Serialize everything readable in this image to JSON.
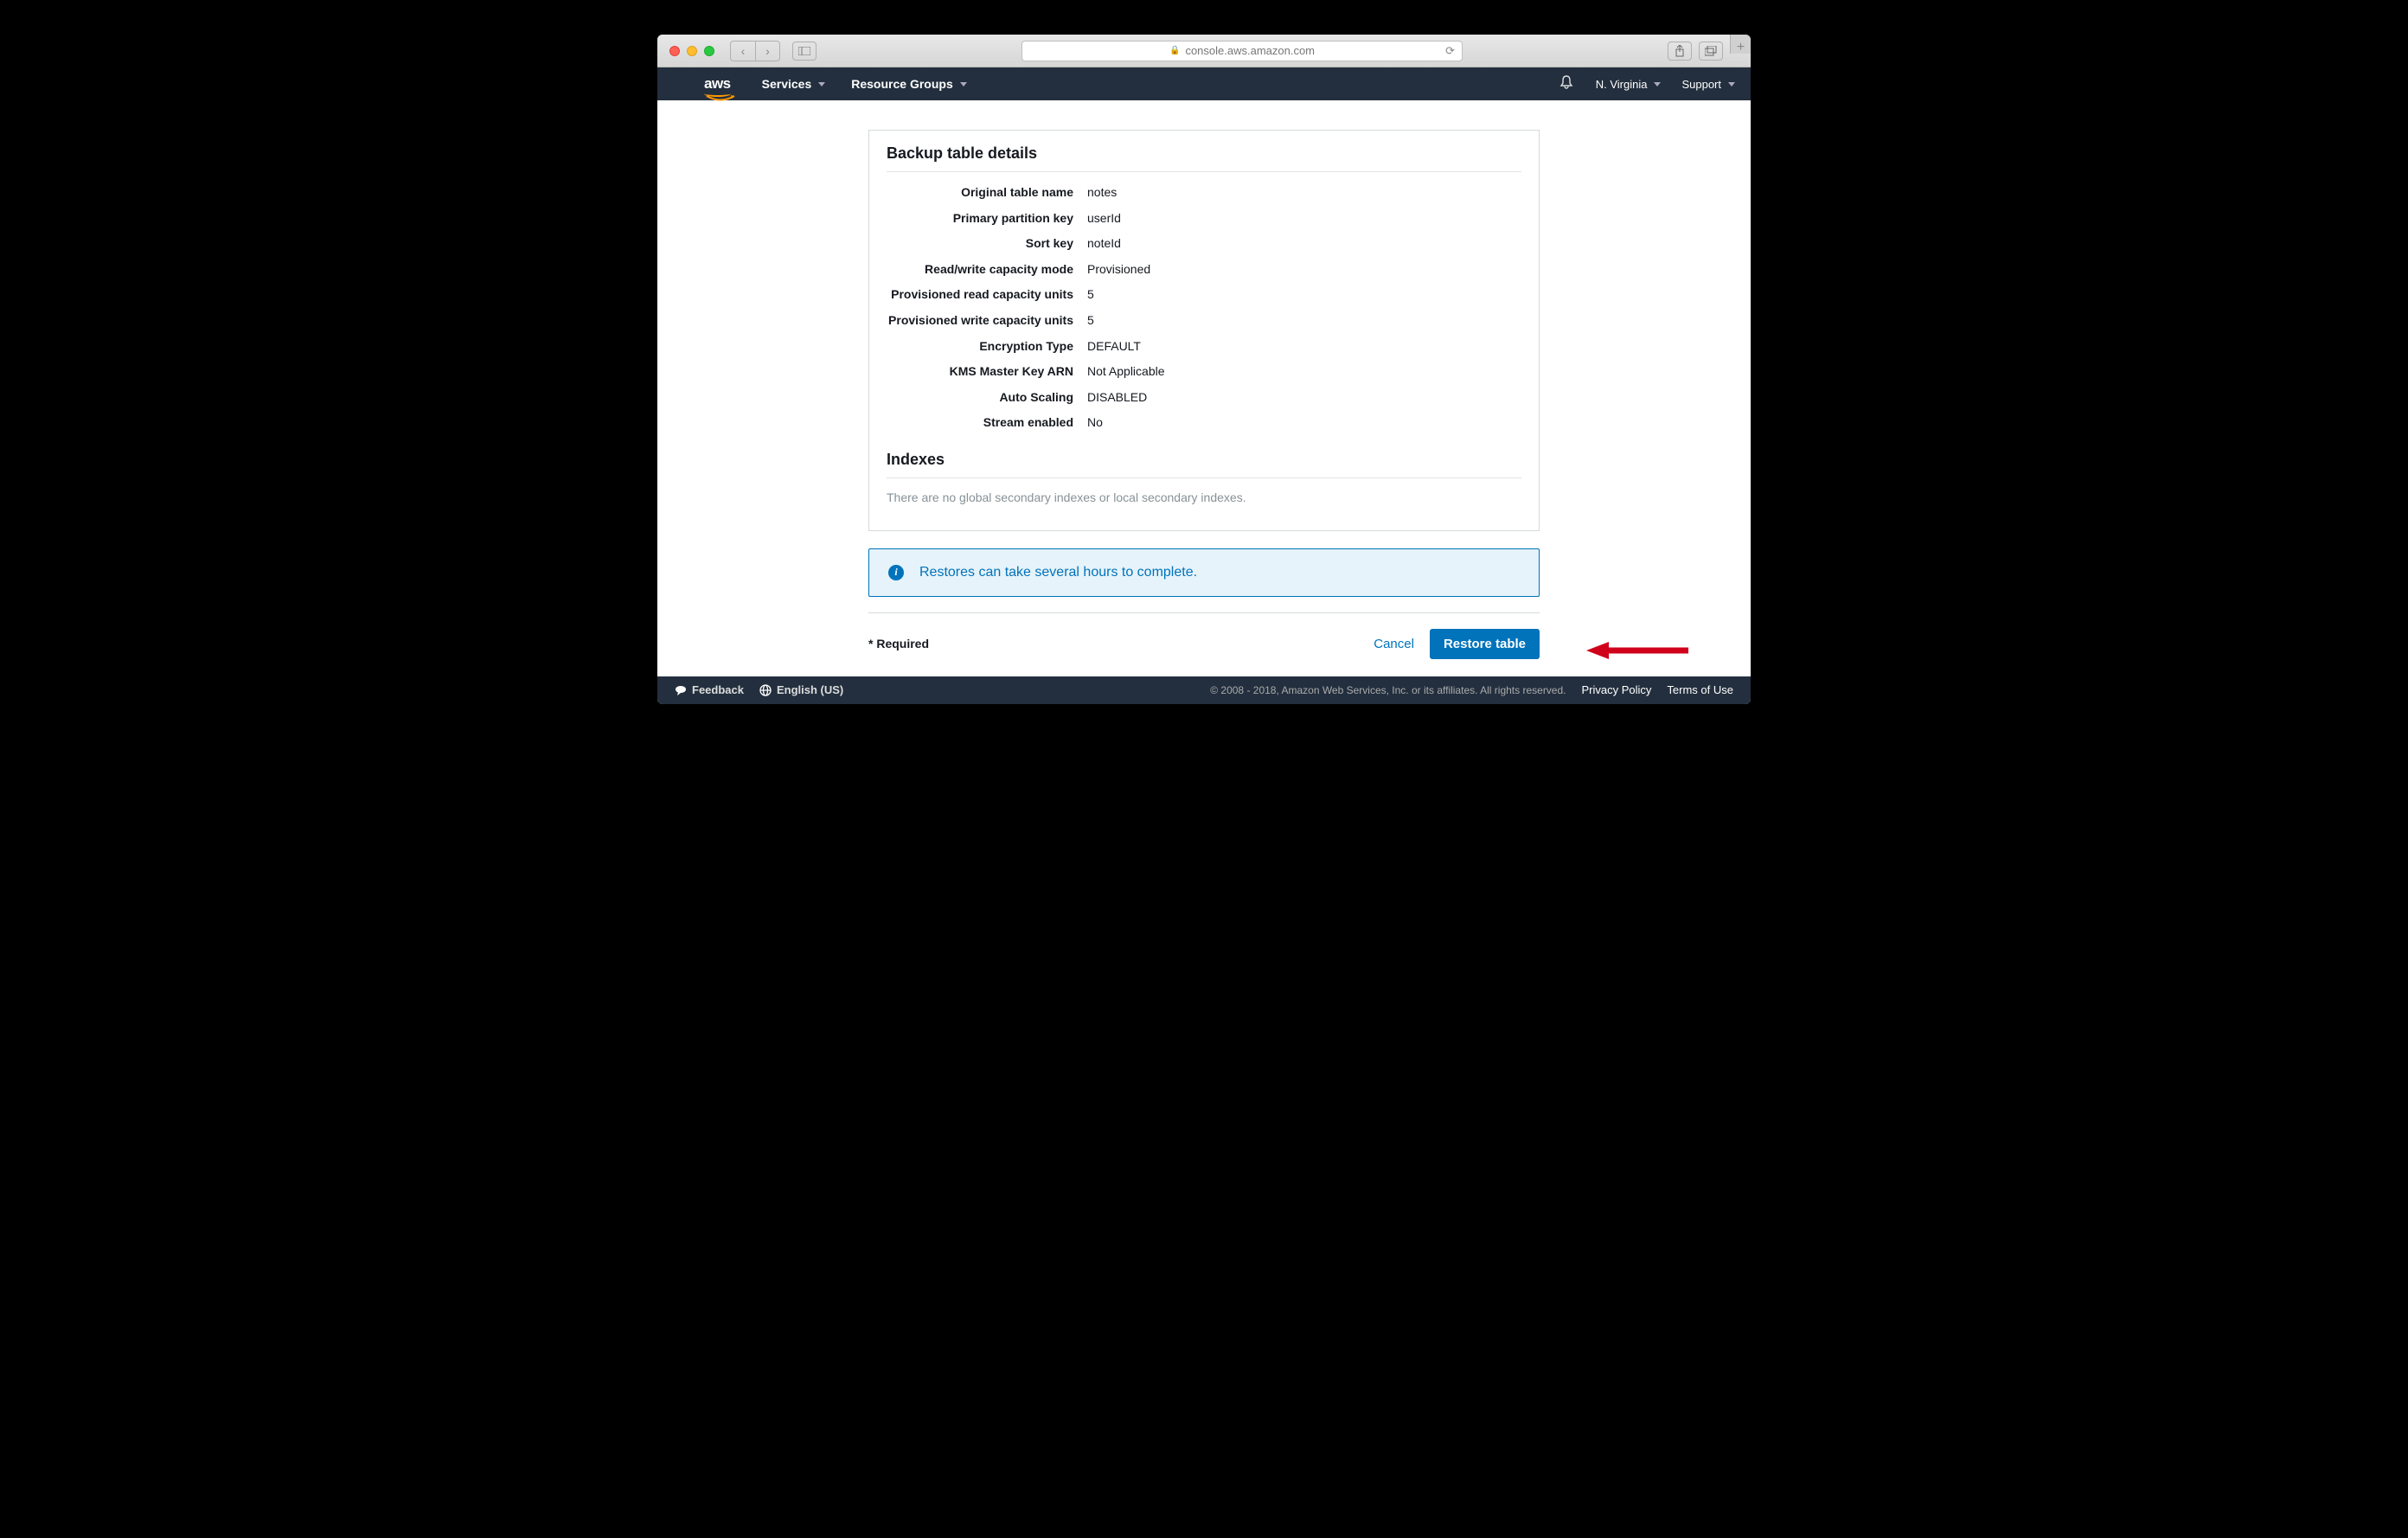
{
  "browser": {
    "url": "console.aws.amazon.com"
  },
  "header": {
    "logo": "aws",
    "services": "Services",
    "resource_groups": "Resource Groups",
    "region": "N. Virginia",
    "support": "Support"
  },
  "panel": {
    "title": "Backup table details",
    "rows": [
      {
        "k": "Original table name",
        "v": "notes"
      },
      {
        "k": "Primary partition key",
        "v": "userId"
      },
      {
        "k": "Sort key",
        "v": "noteId"
      },
      {
        "k": "Read/write capacity mode",
        "v": "Provisioned"
      },
      {
        "k": "Provisioned read capacity units",
        "v": "5"
      },
      {
        "k": "Provisioned write capacity units",
        "v": "5"
      },
      {
        "k": "Encryption Type",
        "v": "DEFAULT"
      },
      {
        "k": "KMS Master Key ARN",
        "v": "Not Applicable"
      },
      {
        "k": "Auto Scaling",
        "v": "DISABLED"
      },
      {
        "k": "Stream enabled",
        "v": "No"
      }
    ],
    "indexes_title": "Indexes",
    "indexes_empty": "There are no global secondary indexes or local secondary indexes."
  },
  "info": {
    "text": "Restores can take several hours to complete."
  },
  "actions": {
    "required": "* Required",
    "cancel": "Cancel",
    "restore": "Restore table"
  },
  "footer": {
    "feedback": "Feedback",
    "language": "English (US)",
    "copyright": "© 2008 - 2018, Amazon Web Services, Inc. or its affiliates. All rights reserved.",
    "privacy": "Privacy Policy",
    "terms": "Terms of Use"
  }
}
